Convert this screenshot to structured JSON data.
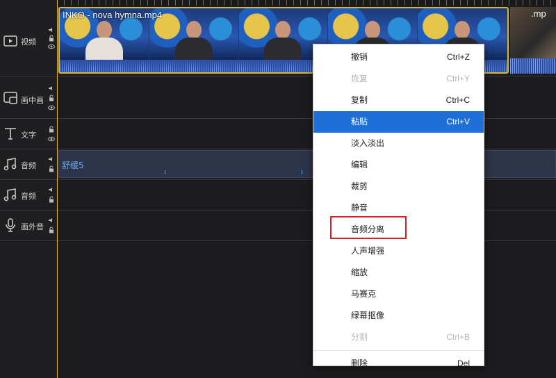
{
  "tracks": [
    {
      "label": "视频",
      "icon": "video-track-icon"
    },
    {
      "label": "画中画",
      "icon": "pip-track-icon"
    },
    {
      "label": "文字",
      "icon": "text-track-icon"
    },
    {
      "label": "音频",
      "icon": "audio-track-icon"
    },
    {
      "label": "音频",
      "icon": "audio-track-icon"
    },
    {
      "label": "画外音",
      "icon": "microphone-icon"
    }
  ],
  "video_clip": {
    "title": "INKO - nova hymna.mp4"
  },
  "video_clip2": {
    "title": ".mp"
  },
  "audio_clip": {
    "name": "舒缓5"
  },
  "context_menu": {
    "items": [
      {
        "label": "撤销",
        "shortcut": "Ctrl+Z",
        "state": "normal"
      },
      {
        "label": "恢复",
        "shortcut": "Ctrl+Y",
        "state": "disabled"
      },
      {
        "label": "复制",
        "shortcut": "Ctrl+C",
        "state": "normal"
      },
      {
        "label": "粘贴",
        "shortcut": "Ctrl+V",
        "state": "selected"
      },
      {
        "label": "淡入淡出",
        "shortcut": "",
        "state": "normal"
      },
      {
        "label": "编辑",
        "shortcut": "",
        "state": "normal"
      },
      {
        "label": "裁剪",
        "shortcut": "",
        "state": "normal"
      },
      {
        "label": "静音",
        "shortcut": "",
        "state": "normal"
      },
      {
        "label": "音频分离",
        "shortcut": "",
        "state": "highlighted"
      },
      {
        "label": "人声增强",
        "shortcut": "",
        "state": "normal"
      },
      {
        "label": "缩放",
        "shortcut": "",
        "state": "normal"
      },
      {
        "label": "马赛克",
        "shortcut": "",
        "state": "normal"
      },
      {
        "label": "绿幕抠像",
        "shortcut": "",
        "state": "normal"
      },
      {
        "label": "分割",
        "shortcut": "Ctrl+B",
        "state": "disabled"
      },
      {
        "label": "删除",
        "shortcut": "Del",
        "state": "normal"
      }
    ]
  },
  "colors": {
    "selected_bg": "#1f6fd8",
    "highlight_border": "#d81e1e",
    "clip_border": "#d9b835",
    "audio_text": "#6fa4e8"
  }
}
